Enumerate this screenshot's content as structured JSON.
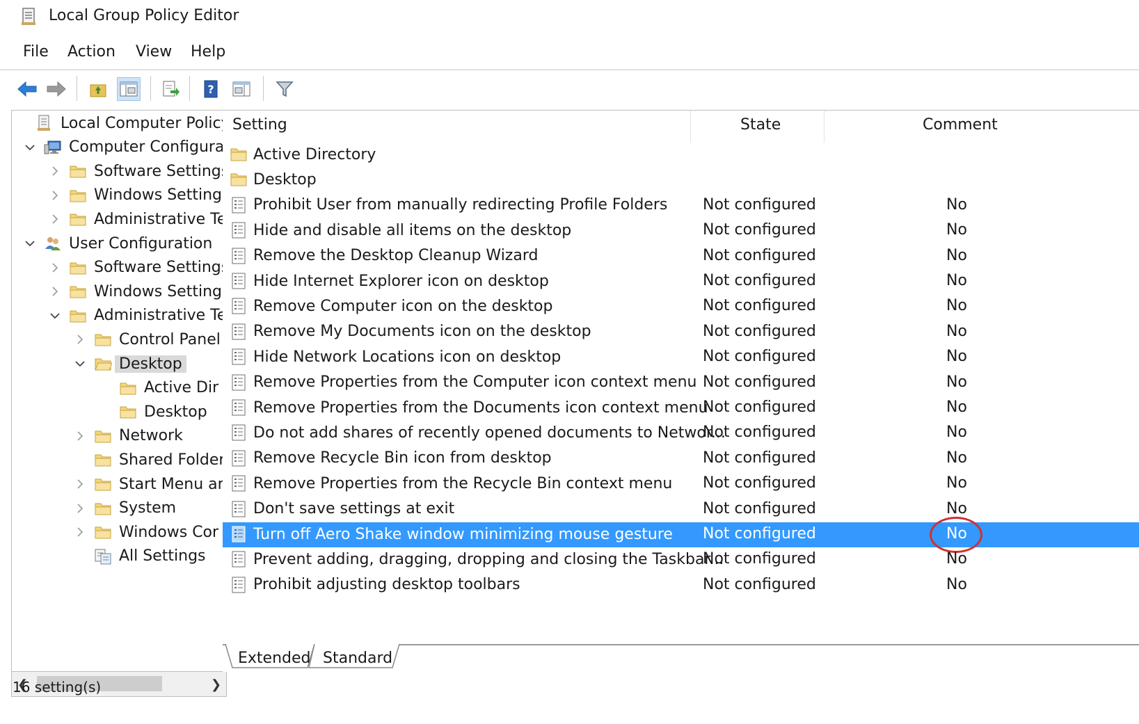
{
  "window": {
    "title": "Local Group Policy Editor"
  },
  "menu": {
    "items": [
      "File",
      "Action",
      "View",
      "Help"
    ]
  },
  "toolbar": {
    "buttons": [
      "back-arrow-icon",
      "forward-arrow-icon",
      "up-folder-icon",
      "show-hide-tree-icon",
      "export-list-icon",
      "help-icon",
      "show-hide-action-pane-icon",
      "filter-icon"
    ]
  },
  "tree": {
    "items": [
      {
        "label": "Local Computer Policy",
        "level": 0,
        "arrow": "",
        "icon": "policy-icon"
      },
      {
        "label": "Computer Configura",
        "level": 1,
        "arrow": "expanded",
        "icon": "computer-icon"
      },
      {
        "label": "Software Settings",
        "level": 2,
        "arrow": "collapsed",
        "icon": "folder-icon"
      },
      {
        "label": "Windows Setting",
        "level": 2,
        "arrow": "collapsed",
        "icon": "folder-icon"
      },
      {
        "label": "Administrative Te",
        "level": 2,
        "arrow": "collapsed",
        "icon": "folder-icon"
      },
      {
        "label": "User Configuration",
        "level": 1,
        "arrow": "expanded",
        "icon": "users-icon"
      },
      {
        "label": "Software Settings",
        "level": 2,
        "arrow": "collapsed",
        "icon": "folder-icon"
      },
      {
        "label": "Windows Setting",
        "level": 2,
        "arrow": "collapsed",
        "icon": "folder-icon"
      },
      {
        "label": "Administrative Te",
        "level": 2,
        "arrow": "expanded",
        "icon": "folder-icon"
      },
      {
        "label": "Control Panel",
        "level": 3,
        "arrow": "collapsed",
        "icon": "folder-icon"
      },
      {
        "label": "Desktop",
        "level": 3,
        "arrow": "expanded",
        "icon": "folder-open-icon",
        "selected": true
      },
      {
        "label": "Active Dir",
        "level": 4,
        "arrow": "",
        "icon": "folder-icon"
      },
      {
        "label": "Desktop",
        "level": 4,
        "arrow": "",
        "icon": "folder-icon"
      },
      {
        "label": "Network",
        "level": 3,
        "arrow": "collapsed",
        "icon": "folder-icon"
      },
      {
        "label": "Shared Folder",
        "level": 3,
        "arrow": "",
        "icon": "folder-icon"
      },
      {
        "label": "Start Menu ar",
        "level": 3,
        "arrow": "collapsed",
        "icon": "folder-icon"
      },
      {
        "label": "System",
        "level": 3,
        "arrow": "collapsed",
        "icon": "folder-icon"
      },
      {
        "label": "Windows Cor",
        "level": 3,
        "arrow": "collapsed",
        "icon": "folder-icon"
      },
      {
        "label": "All Settings",
        "level": 3,
        "arrow": "",
        "icon": "all-settings-icon"
      }
    ]
  },
  "list": {
    "headers": {
      "setting": "Setting",
      "state": "State",
      "comment": "Comment"
    },
    "rows": [
      {
        "setting": "Active Directory",
        "state": "",
        "comment": "",
        "type": "folder"
      },
      {
        "setting": "Desktop",
        "state": "",
        "comment": "",
        "type": "folder"
      },
      {
        "setting": "Prohibit User from manually redirecting Profile Folders",
        "state": "Not configured",
        "comment": "No",
        "type": "policy"
      },
      {
        "setting": "Hide and disable all items on the desktop",
        "state": "Not configured",
        "comment": "No",
        "type": "policy"
      },
      {
        "setting": "Remove the Desktop Cleanup Wizard",
        "state": "Not configured",
        "comment": "No",
        "type": "policy"
      },
      {
        "setting": "Hide Internet Explorer icon on desktop",
        "state": "Not configured",
        "comment": "No",
        "type": "policy"
      },
      {
        "setting": "Remove Computer icon on the desktop",
        "state": "Not configured",
        "comment": "No",
        "type": "policy"
      },
      {
        "setting": "Remove My Documents icon on the desktop",
        "state": "Not configured",
        "comment": "No",
        "type": "policy"
      },
      {
        "setting": "Hide Network Locations icon on desktop",
        "state": "Not configured",
        "comment": "No",
        "type": "policy"
      },
      {
        "setting": "Remove Properties from the Computer icon context menu",
        "state": "Not configured",
        "comment": "No",
        "type": "policy"
      },
      {
        "setting": "Remove Properties from the Documents icon context menu",
        "state": "Not configured",
        "comment": "No",
        "type": "policy"
      },
      {
        "setting": "Do not add shares of recently opened documents to Networ...",
        "state": "Not configured",
        "comment": "No",
        "type": "policy"
      },
      {
        "setting": "Remove Recycle Bin icon from desktop",
        "state": "Not configured",
        "comment": "No",
        "type": "policy"
      },
      {
        "setting": "Remove Properties from the Recycle Bin context menu",
        "state": "Not configured",
        "comment": "No",
        "type": "policy"
      },
      {
        "setting": "Don't save settings at exit",
        "state": "Not configured",
        "comment": "No",
        "type": "policy"
      },
      {
        "setting": "Turn off Aero Shake window minimizing mouse gesture",
        "state": "Not configured",
        "comment": "No",
        "type": "policy",
        "selected": true,
        "circled": true
      },
      {
        "setting": "Prevent adding, dragging, dropping and closing the Taskbar...",
        "state": "Not configured",
        "comment": "No",
        "type": "policy"
      },
      {
        "setting": "Prohibit adjusting desktop toolbars",
        "state": "Not configured",
        "comment": "No",
        "type": "policy"
      }
    ]
  },
  "tabs": [
    "Extended",
    "Standard"
  ],
  "status": {
    "text": "16 setting(s)"
  },
  "colors": {
    "selection": "#3399ff",
    "highlight_ring": "#d23030",
    "tree_selection": "#d9d9d9"
  }
}
